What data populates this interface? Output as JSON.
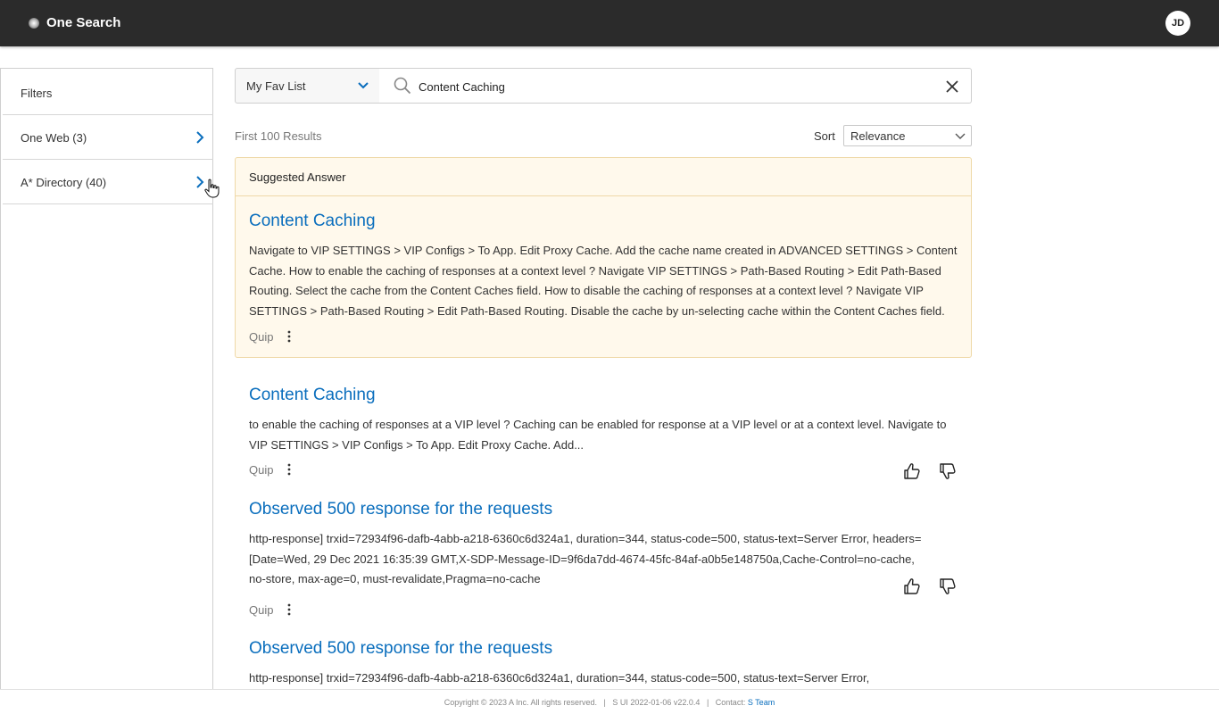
{
  "header": {
    "app_title": "One Search",
    "user_initials": "JD"
  },
  "sidebar": {
    "title": "Filters",
    "items": [
      {
        "label": "One Web (3)"
      },
      {
        "label": "A* Directory (40)"
      }
    ]
  },
  "search": {
    "scope_value": "My Fav List",
    "query": "Content Caching"
  },
  "results_summary": "First 100 Results",
  "sort": {
    "label": "Sort",
    "value": "Relevance"
  },
  "suggested": {
    "heading": "Suggested Answer",
    "title": "Content Caching",
    "snippet": "Navigate to VIP SETTINGS > VIP Configs > To App. Edit Proxy Cache. Add the cache name created in ADVANCED SETTINGS > Content Cache. How to enable the caching of responses at a context level ? Navigate VIP SETTINGS > Path-Based Routing > Edit Path-Based Routing. Select the cache from the Content Caches field. How to disable the caching of responses at a context level ? Navigate VIP SETTINGS > Path-Based Routing > Edit Path-Based Routing. Disable the cache by un-selecting cache within the Content Caches field.",
    "source": "Quip"
  },
  "results": [
    {
      "title": "Content Caching",
      "snippet": "to enable the caching of responses at a VIP level ? Caching can be enabled for response at a VIP level or at a context level. Navigate to VIP SETTINGS > VIP Configs > To App. Edit Proxy Cache. Add...",
      "source": "Quip"
    },
    {
      "title": "Observed 500 response for the requests",
      "snippet": "http-response] trxid=72934f96-dafb-4abb-a218-6360c6d324a1, duration=344, status-code=500, status-text=Server Error, headers=[Date=Wed, 29 Dec 2021 16:35:39 GMT,X-SDP-Message-ID=9f6da7dd-4674-45fc-84af-a0b5e148750a,Cache-Control=no-cache, no-store, max-age=0, must-revalidate,Pragma=no-cache",
      "source": "Quip"
    },
    {
      "title": "Observed 500 response for the requests",
      "snippet": "http-response] trxid=72934f96-dafb-4abb-a218-6360c6d324a1, duration=344, status-code=500, status-text=Server Error,"
    }
  ],
  "footer": {
    "copyright": "Copyright © 2023 A Inc. All rights reserved.",
    "version": "S UI 2022-01-06 v22.0.4",
    "contact_label": "Contact:",
    "contact_link": "S Team"
  },
  "colors": {
    "link": "#0a6ebd",
    "header_bg": "#2b2b2b",
    "suggested_bg": "#fff9ec",
    "suggested_border": "#efd9a8"
  },
  "icons": [
    "logo-icon",
    "chevron-right-icon",
    "chevron-down-icon",
    "search-icon",
    "close-icon",
    "more-vertical-icon",
    "thumbs-up-icon",
    "thumbs-down-icon",
    "hand-cursor-icon"
  ]
}
